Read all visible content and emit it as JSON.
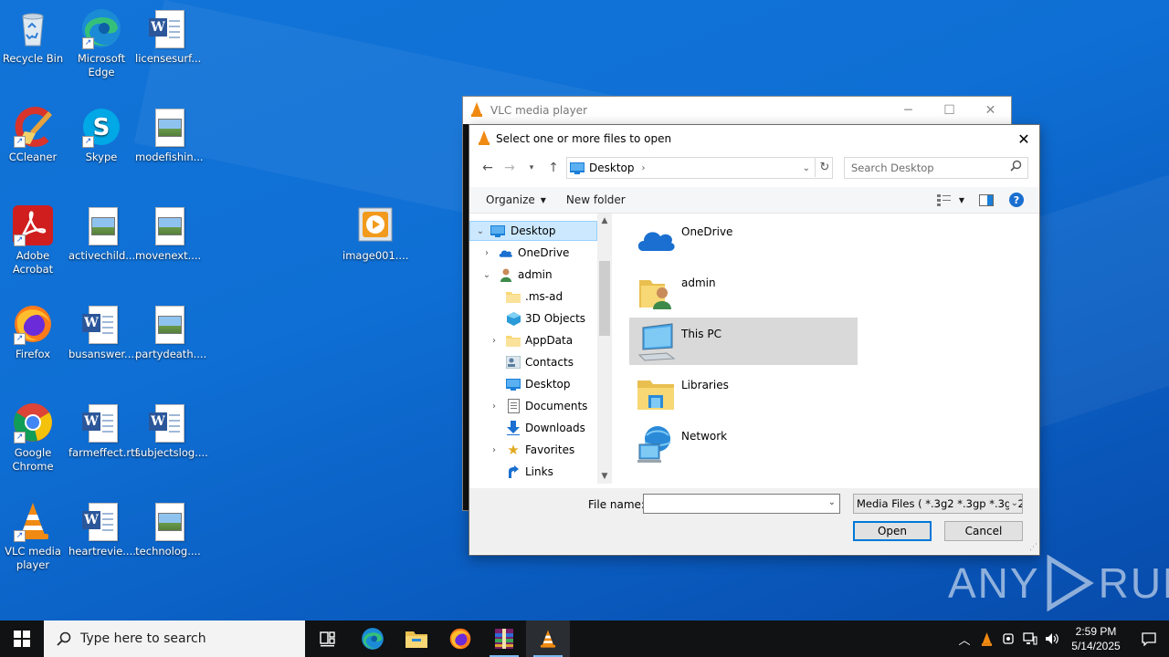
{
  "desktop": {
    "icons": [
      {
        "label_1": "Recycle Bin",
        "label_2": ""
      },
      {
        "label_1": "Microsoft",
        "label_2": "Edge"
      },
      {
        "label_1": "licensesurf...",
        "label_2": ""
      },
      {
        "label_1": "CCleaner",
        "label_2": ""
      },
      {
        "label_1": "Skype",
        "label_2": ""
      },
      {
        "label_1": "modefishin...",
        "label_2": ""
      },
      {
        "label_1": "Adobe",
        "label_2": "Acrobat"
      },
      {
        "label_1": "activechild...",
        "label_2": ""
      },
      {
        "label_1": "movenext....",
        "label_2": ""
      },
      {
        "label_1": "image001....",
        "label_2": ""
      },
      {
        "label_1": "Firefox",
        "label_2": ""
      },
      {
        "label_1": "busanswer....",
        "label_2": ""
      },
      {
        "label_1": "partydeath....",
        "label_2": ""
      },
      {
        "label_1": "Google",
        "label_2": "Chrome"
      },
      {
        "label_1": "farmeffect.rtf",
        "label_2": ""
      },
      {
        "label_1": "subjectslog....",
        "label_2": ""
      },
      {
        "label_1": "VLC media",
        "label_2": "player"
      },
      {
        "label_1": "heartrevie....",
        "label_2": ""
      },
      {
        "label_1": "technolog....",
        "label_2": ""
      }
    ]
  },
  "vlc_window": {
    "title": "VLC media player"
  },
  "dialog": {
    "title": "Select one or more files to open",
    "address": "Desktop",
    "search_placeholder": "Search Desktop",
    "toolbar": {
      "organize": "Organize",
      "new_folder": "New folder"
    },
    "tree": [
      {
        "label": "Desktop"
      },
      {
        "label": "OneDrive"
      },
      {
        "label": "admin"
      },
      {
        "label": ".ms-ad"
      },
      {
        "label": "3D Objects"
      },
      {
        "label": "AppData"
      },
      {
        "label": "Contacts"
      },
      {
        "label": "Desktop"
      },
      {
        "label": "Documents"
      },
      {
        "label": "Downloads"
      },
      {
        "label": "Favorites"
      },
      {
        "label": "Links"
      }
    ],
    "items": [
      {
        "label": "OneDrive"
      },
      {
        "label": "admin"
      },
      {
        "label": "This PC"
      },
      {
        "label": "Libraries"
      },
      {
        "label": "Network"
      }
    ],
    "file_name_label": "File name:",
    "file_name_value": "",
    "filter": "Media Files ( *.3g2 *.3gp *.3gp2",
    "open_label": "Open",
    "cancel_label": "Cancel"
  },
  "watermark": {
    "left": "ANY",
    "right": "RUN"
  },
  "taskbar": {
    "search_placeholder": "Type here to search",
    "time": "2:59 PM",
    "date": "5/14/2025"
  }
}
